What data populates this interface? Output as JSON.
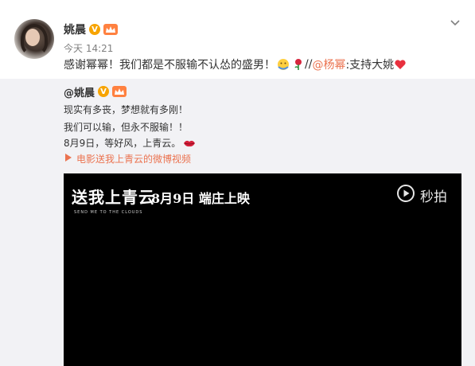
{
  "post": {
    "author": "姚晨",
    "time": "今天 14:21",
    "text_main": "感谢幂幂！我们都是不服输不认怂的盛男！",
    "text_sep": " //",
    "mention": "@杨幂",
    "text_tail": ":支持大姚"
  },
  "repost": {
    "author": "@姚晨",
    "lines": [
      "现实有多丧，梦想就有多刚！",
      "我们可以输，但永不服输！！",
      "8月9日，等好风，上青云。"
    ],
    "video_link": "电影送我上青云的微博视频"
  },
  "video": {
    "title": "送我上青云",
    "subtitle": "SEND ME TO THE CLOUDS",
    "release": "8月9日 端庄上映",
    "brand": "秒拍"
  },
  "colors": {
    "accent": "#eb7350",
    "verified": "#f7a400",
    "repost_bg": "#f2f2f5"
  },
  "icons": [
    "verified-badge-icon",
    "vip-crown-icon",
    "chevron-down-icon",
    "hug-emoji-icon",
    "rose-emoji-icon",
    "heart-emoji-icon",
    "lips-emoji-icon",
    "video-link-icon",
    "miaopai-logo-icon"
  ]
}
